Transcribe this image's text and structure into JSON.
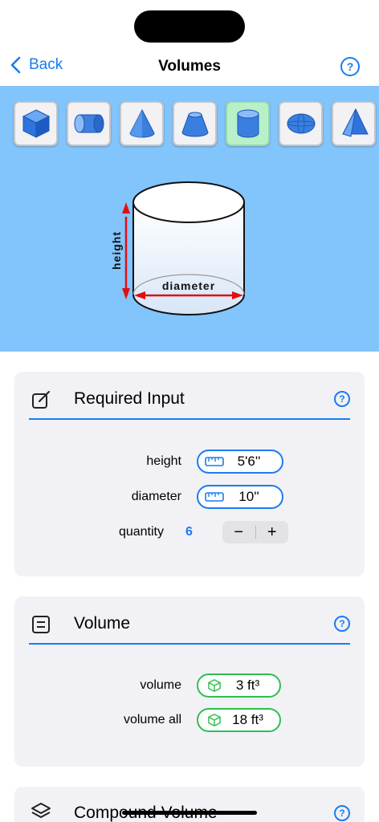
{
  "nav": {
    "back_label": "Back",
    "title": "Volumes",
    "help_glyph": "?"
  },
  "shapes": [
    {
      "name": "cube",
      "active": false
    },
    {
      "name": "horizontal-cylinder",
      "active": false
    },
    {
      "name": "cone",
      "active": false
    },
    {
      "name": "truncated-cone",
      "active": false
    },
    {
      "name": "cylinder",
      "active": true
    },
    {
      "name": "ellipsoid",
      "active": false
    },
    {
      "name": "pyramid",
      "active": false
    }
  ],
  "diagram": {
    "height_label": "height",
    "diameter_label": "diameter"
  },
  "required_input": {
    "title": "Required Input",
    "help_glyph": "?",
    "height": {
      "label": "height",
      "value": "5'6''"
    },
    "diameter": {
      "label": "diameter",
      "value": "10''"
    },
    "quantity": {
      "label": "quantity",
      "value": "6",
      "minus": "−",
      "plus": "+"
    }
  },
  "volume": {
    "title": "Volume",
    "help_glyph": "?",
    "volume": {
      "label": "volume",
      "value": "3 ft³"
    },
    "volume_all": {
      "label": "volume all",
      "value": "18 ft³"
    }
  },
  "compound": {
    "title": "Compound Volume",
    "help_glyph": "?"
  },
  "colors": {
    "accent": "#1a7cf0",
    "hero_bg": "#82c4fc",
    "result_border": "#2fbf4f",
    "active_shape": "#b8f0c8",
    "dimension_arrow": "#e01010"
  }
}
